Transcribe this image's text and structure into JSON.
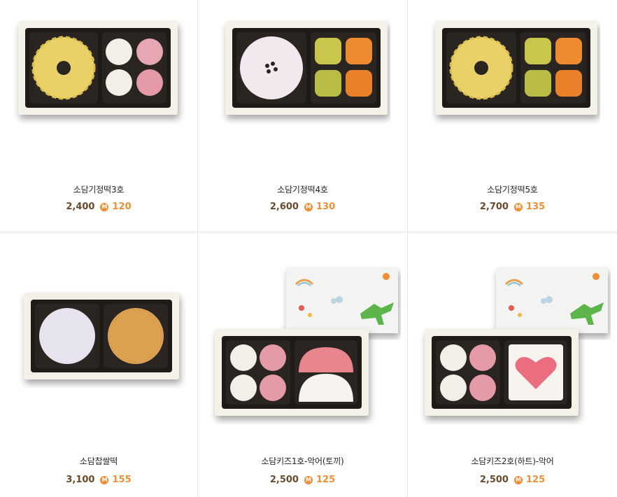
{
  "currency_icon": "mileage-m-icon",
  "colors": {
    "price": "#6b4a2a",
    "mileage": "#ee8f35"
  },
  "products": [
    {
      "name": "소담기정떡3호",
      "price": "2,400",
      "badge": "M",
      "mileage": "120"
    },
    {
      "name": "소담기정떡4호",
      "price": "2,600",
      "badge": "M",
      "mileage": "130"
    },
    {
      "name": "소담기정떡5호",
      "price": "2,700",
      "badge": "M",
      "mileage": "135"
    },
    {
      "name": "소담찹쌀떡",
      "price": "3,100",
      "badge": "M",
      "mileage": "155"
    },
    {
      "name": "소담키즈1호-악어(토끼)",
      "price": "2,500",
      "badge": "M",
      "mileage": "125"
    },
    {
      "name": "소담키즈2호(하트)-악어",
      "price": "2,500",
      "badge": "M",
      "mileage": "125"
    }
  ]
}
